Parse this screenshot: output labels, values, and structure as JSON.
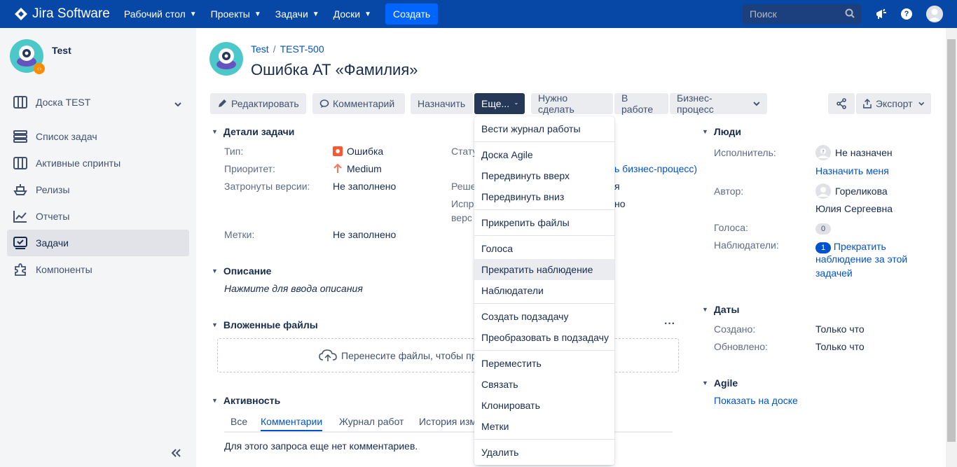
{
  "topbar": {
    "logo": "Jira Software",
    "nav": [
      "Рабочий стол",
      "Проекты",
      "Задачи",
      "Доски"
    ],
    "create": "Создать",
    "search_placeholder": "Поиск"
  },
  "sidebar": {
    "project_name": "Test",
    "board": "Доска TEST",
    "items": [
      "Список задач",
      "Активные спринты",
      "Релизы",
      "Отчеты",
      "Задачи",
      "Компоненты"
    ],
    "active_item": "Задачи"
  },
  "issue": {
    "breadcrumb_project": "Test",
    "breadcrumb_key": "TEST-500",
    "title": "Ошибка АТ «Фамилия»"
  },
  "toolbar": {
    "edit": "Редактировать",
    "comment": "Комментарий",
    "assign": "Назначить",
    "more": "Еще...",
    "todo": "Нужно сделать",
    "in_progress": "В работе",
    "workflow": "Бизнес-процесс",
    "export": "Экспорт"
  },
  "details": {
    "header": "Детали задачи",
    "type_label": "Тип:",
    "type_value": "Ошибка",
    "priority_label": "Приоритет:",
    "priority_value": "Medium",
    "affects_label": "Затронуты версии:",
    "affects_value": "Не заполнено",
    "labels_label": "Метки:",
    "labels_value": "Не заполнено",
    "status_label_partial": "Стату",
    "resolution_label_partial": "Реше",
    "fix_label_partial_1": "Испр",
    "fix_label_partial_2": "верс",
    "workflow_link_partial": "ь бизнес-процесс)",
    "resolution_value_partial": "я",
    "fix_value_partial": "но"
  },
  "description": {
    "header": "Описание",
    "placeholder": "Нажмите для ввода описания"
  },
  "attachments": {
    "header": "Вложенные файлы",
    "drop_text": "Перенесите файлы, чтобы при"
  },
  "activity": {
    "header": "Активность",
    "tabs": [
      "Все",
      "Комментарии",
      "Журнал работ",
      "История изм"
    ],
    "active_tab": "Комментарии",
    "empty": "Для этого запроса еще нет комментариев."
  },
  "dropdown": {
    "groups": [
      [
        "Вести журнал работы"
      ],
      [
        "Доска Agile",
        "Передвинуть вверх",
        "Передвинуть вниз"
      ],
      [
        "Прикрепить файлы"
      ],
      [
        "Голоса",
        "Прекратить наблюдение",
        "Наблюдатели"
      ],
      [
        "Создать подзадачу",
        "Преобразовать в подзадачу"
      ],
      [
        "Переместить",
        "Связать",
        "Клонировать",
        "Метки"
      ],
      [
        "Удалить"
      ]
    ],
    "hovered": "Прекратить наблюдение"
  },
  "people": {
    "header": "Люди",
    "assignee_label": "Исполнитель:",
    "assignee_value": "Не назначен",
    "assign_me": "Назначить меня",
    "reporter_label": "Автор:",
    "reporter_value_1": "Гореликова",
    "reporter_value_2": "Юлия Сергеевна",
    "votes_label": "Голоса:",
    "votes_count": "0",
    "watchers_label": "Наблюдатели:",
    "watchers_count": "1",
    "stop_watching_1": "Прекратить",
    "stop_watching_2": "наблюдение за этой",
    "stop_watching_3": "задачей"
  },
  "dates": {
    "header": "Даты",
    "created_label": "Создано:",
    "created_value": "Только что",
    "updated_label": "Обновлено:",
    "updated_value": "Только что"
  },
  "agile": {
    "header": "Agile",
    "link": "Показать на доске"
  },
  "colors": {
    "nav_bg": "#0747a6",
    "create_bg": "#0065ff",
    "link": "#0052cc",
    "bug_red": "#ff5630",
    "priority_orange": "#ff7452"
  }
}
